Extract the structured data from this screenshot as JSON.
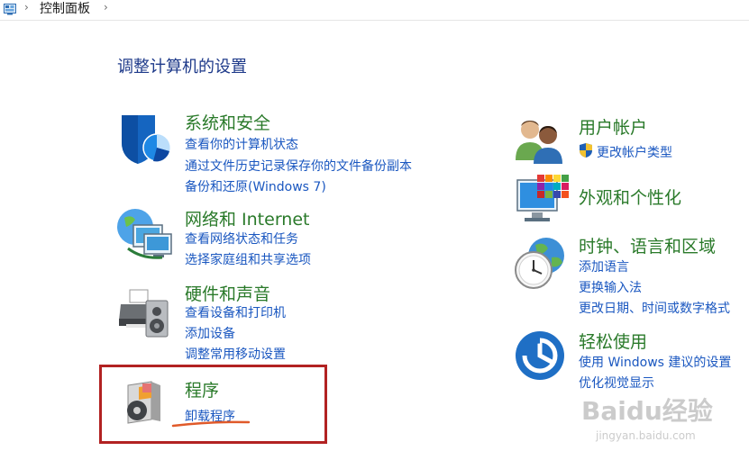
{
  "breadcrumb": {
    "title": "控制面板"
  },
  "page_title": "调整计算机的设置",
  "left": [
    {
      "title": "系统和安全",
      "links": [
        "查看你的计算机状态",
        "通过文件历史记录保存你的文件备份副本",
        "备份和还原(Windows 7)"
      ]
    },
    {
      "title": "网络和 Internet",
      "links": [
        "查看网络状态和任务",
        "选择家庭组和共享选项"
      ]
    },
    {
      "title": "硬件和声音",
      "links": [
        "查看设备和打印机",
        "添加设备",
        "调整常用移动设置"
      ]
    },
    {
      "title": "程序",
      "links": [
        "卸载程序"
      ]
    }
  ],
  "right": [
    {
      "title": "用户帐户",
      "links": [
        "更改帐户类型"
      ]
    },
    {
      "title": "外观和个性化",
      "links": []
    },
    {
      "title": "时钟、语言和区域",
      "links": [
        "添加语言",
        "更换输入法",
        "更改日期、时间或数字格式"
      ]
    },
    {
      "title": "轻松使用",
      "links": [
        "使用 Windows 建议的设置",
        "优化视觉显示"
      ]
    }
  ],
  "watermark": {
    "logo": "Baidu经验",
    "url": "jingyan.baidu.com"
  },
  "colors": {
    "title_green": "#2a7a2a",
    "link_blue": "#1a57c0",
    "highlight_red": "#b22222",
    "underline_orange": "#e05a2a"
  }
}
